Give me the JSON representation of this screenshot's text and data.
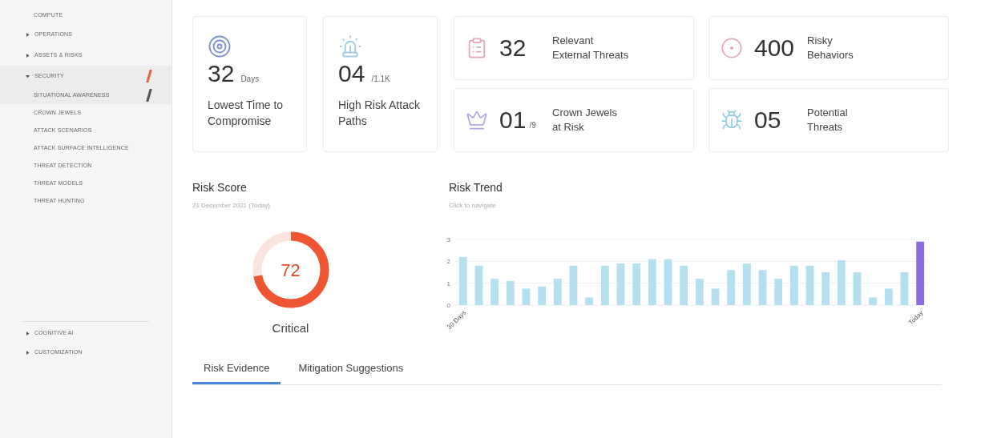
{
  "sidebar": {
    "items": [
      {
        "label": "COMPUTE",
        "kind": "link"
      },
      {
        "label": "OPERATIONS",
        "kind": "group",
        "expanded": false,
        "selected": false
      },
      {
        "label": "ASSETS & RISKS",
        "kind": "group",
        "expanded": false,
        "selected": false
      },
      {
        "label": "SECURITY",
        "kind": "group",
        "expanded": true,
        "selected": true,
        "children": [
          {
            "label": "SITUATIONAL AWARENESS",
            "selected": true
          },
          {
            "label": "CROWN JEWELS",
            "selected": false
          },
          {
            "label": "ATTACK SCENARIOS",
            "selected": false
          },
          {
            "label": "ATTACK SURFACE INTELLIGENCE",
            "selected": false
          },
          {
            "label": "THREAT DETECTION",
            "selected": false
          },
          {
            "label": "THREAT MODELS",
            "selected": false
          },
          {
            "label": "THREAT HUNTING",
            "selected": false
          }
        ]
      }
    ],
    "bottom_items": [
      {
        "label": "COGNITIVE AI",
        "expanded": false
      },
      {
        "label": "CUSTOMIZATION",
        "expanded": false
      }
    ]
  },
  "metrics": [
    {
      "kind": "tall",
      "value": "32",
      "unit": "Days",
      "label": "Lowest Time to Compromise"
    },
    {
      "kind": "tall",
      "value": "04",
      "unit": "/1.1K",
      "label": "High Risk Attack Paths"
    },
    {
      "kind": "wide",
      "value": "32",
      "label_lines": [
        "Relevant",
        "External Threats"
      ]
    },
    {
      "kind": "wide",
      "value": "400",
      "label_lines": [
        "Risky",
        "Behaviors"
      ]
    },
    {
      "kind": "wide",
      "value": "01",
      "unit": "/9",
      "label_lines": [
        "Crown Jewels",
        "at Risk"
      ]
    },
    {
      "kind": "wide",
      "value": "05",
      "label_lines": [
        "Potential",
        "Threats"
      ]
    }
  ],
  "risk_score": {
    "title": "Risk Score",
    "date": "21 December 2021 (Today)",
    "value": "72",
    "level": 0.72,
    "rating": "Critical"
  },
  "risk_trend": {
    "title": "Risk Trend",
    "subtitle": "Click to navigate",
    "chart_data": {
      "type": "bar",
      "ylim": [
        0,
        3
      ],
      "yticks": [
        0,
        1,
        2,
        3
      ],
      "categories": [
        "30 Days",
        null,
        null,
        null,
        null,
        null,
        null,
        null,
        null,
        null,
        null,
        null,
        null,
        null,
        null,
        null,
        null,
        null,
        null,
        null,
        null,
        null,
        null,
        null,
        null,
        null,
        null,
        null,
        null,
        "Today"
      ],
      "stacked": true,
      "series": [
        {
          "color": "#b4e0f0",
          "values": [
            2.2,
            1.8,
            1.2,
            1.1,
            0.75,
            0.85,
            1.2,
            1.8,
            0.35,
            1.8,
            1.9,
            1.9,
            2.1,
            2.1,
            1.8,
            1.2,
            0.75,
            1.6,
            1.9,
            1.6,
            1.2,
            1.8,
            1.8,
            1.5,
            2.05,
            1.5,
            0.35,
            0.75,
            1.5,
            null
          ]
        },
        {
          "color": "#8c6ce0",
          "values": [
            null,
            null,
            null,
            null,
            null,
            null,
            null,
            null,
            null,
            null,
            null,
            null,
            null,
            null,
            null,
            null,
            null,
            null,
            null,
            null,
            null,
            null,
            null,
            null,
            null,
            null,
            null,
            null,
            null,
            2.9
          ]
        }
      ]
    }
  },
  "tabs": [
    {
      "label": "Risk Evidence",
      "selected": true
    },
    {
      "label": "Mitigation Suggestions",
      "selected": false
    }
  ]
}
